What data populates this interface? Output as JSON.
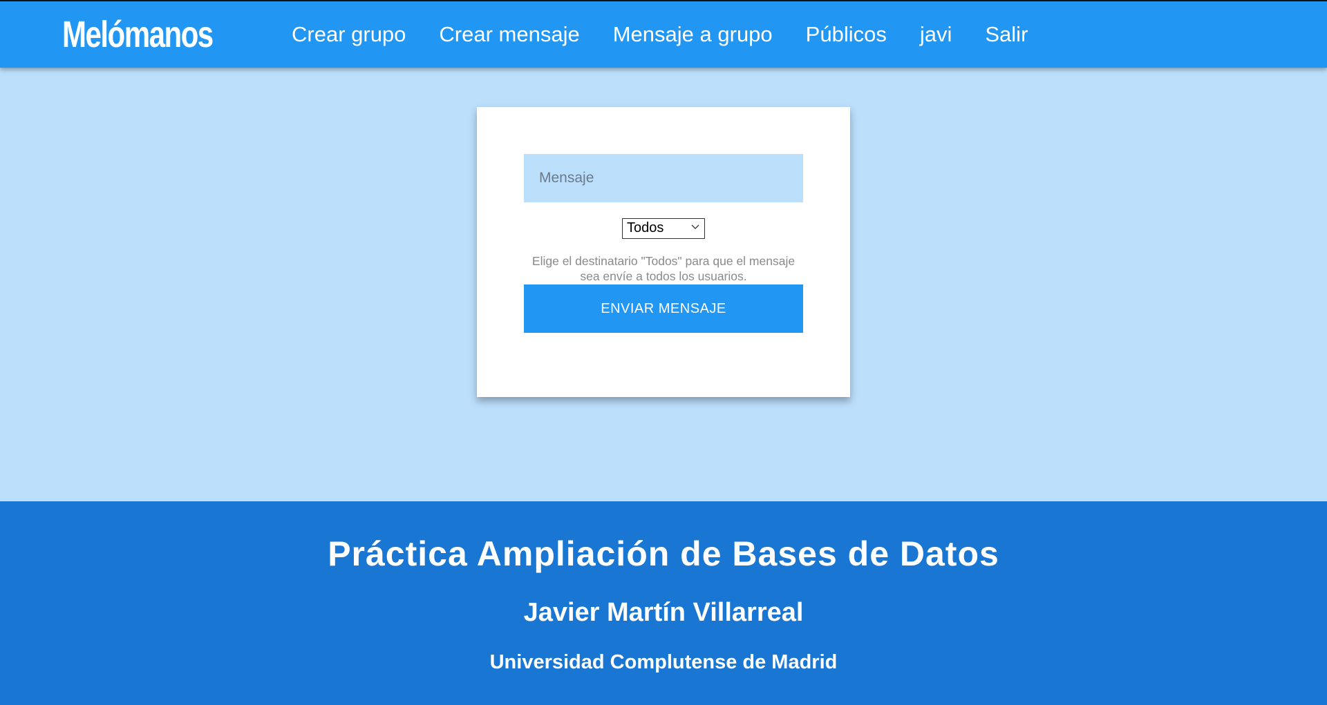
{
  "navbar": {
    "brand": "Melómanos",
    "links": [
      "Crear grupo",
      "Crear mensaje",
      "Mensaje a grupo",
      "Públicos",
      "javi",
      "Salir"
    ],
    "color": "#2196f3"
  },
  "form": {
    "message_placeholder": "Mensaje",
    "recipient_selected": "Todos",
    "hint": "Elige el destinatario \"Todos\" para que el mensaje sea envíe a todos los usuarios.",
    "send_label": "ENVIAR MENSAJE"
  },
  "footer": {
    "title": "Práctica Ampliación de Bases de Datos",
    "author": "Javier Martín Villarreal",
    "university": "Universidad Complutense de Madrid",
    "color": "#1976d2"
  },
  "theme": {
    "background": "#bbdefb",
    "accent": "#2196f3"
  }
}
